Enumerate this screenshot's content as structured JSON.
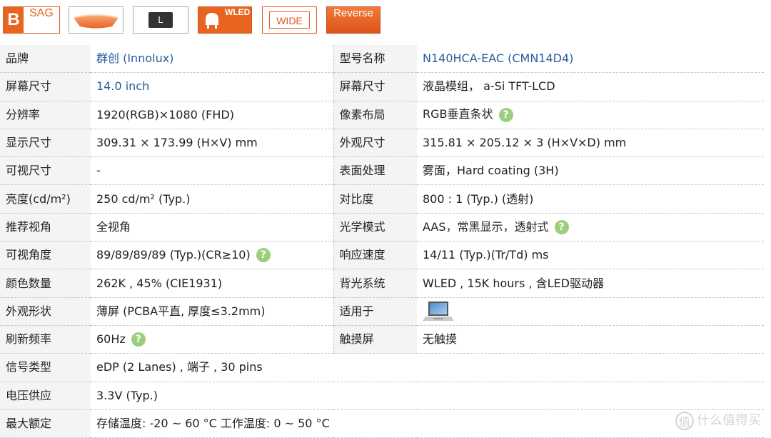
{
  "badges": {
    "sag": {
      "letter": "B",
      "text": "SAG",
      "icon": "sag-panel-icon"
    },
    "screen": {
      "icon": "panel-curve-icon"
    },
    "l": {
      "text": "L",
      "icon": "l-badge-icon"
    },
    "wled": {
      "text": "WLED",
      "icon": "wled-bulb-icon"
    },
    "wide": {
      "text": "WIDE",
      "icon": "wide-gamut-icon"
    },
    "reverse": {
      "text": "Reverse",
      "icon": "reverse-icon"
    }
  },
  "colors": {
    "accent": "#e8641f",
    "link": "#2a5d9c",
    "help": "#9ccf7c",
    "label_bg": "#f4f4f4"
  },
  "rows": [
    {
      "l1": "品牌",
      "v1": "群创 (Innolux)",
      "l2": "型号名称",
      "v2": "N140HCA-EAC (CMN14D4)"
    },
    {
      "l1": "屏幕尺寸",
      "v1": "14.0 inch",
      "l2": "屏幕尺寸",
      "v2": "液晶模组， a-Si TFT-LCD"
    },
    {
      "l1": "分辨率",
      "v1": "1920(RGB)×1080 (FHD)",
      "l2": "像素布局",
      "v2": "RGB垂直条状"
    },
    {
      "l1": "显示尺寸",
      "v1": "309.31 × 173.99 (H×V) mm",
      "l2": "外观尺寸",
      "v2": "315.81 × 205.12 × 3 (H×V×D) mm"
    },
    {
      "l1": "可视尺寸",
      "v1": "-",
      "l2": "表面处理",
      "v2": "雾面，Hard coating (3H)"
    },
    {
      "l1": "亮度(cd/m²)",
      "v1": "250 cd/m² (Typ.)",
      "l2": "对比度",
      "v2": "800 : 1 (Typ.) (透射)"
    },
    {
      "l1": "推荐视角",
      "v1": "全视角",
      "l2": "光学模式",
      "v2": "AAS，常黑显示，透射式"
    },
    {
      "l1": "可视角度",
      "v1": "89/89/89/89 (Typ.)(CR≥10)",
      "l2": "响应速度",
      "v2": "14/11 (Typ.)(Tr/Td) ms"
    },
    {
      "l1": "颜色数量",
      "v1": "262K , 45% (CIE1931)",
      "l2": "背光系统",
      "v2": "WLED , 15K hours , 含LED驱动器"
    },
    {
      "l1": "外观形状",
      "v1": "薄屏 (PCBA平直, 厚度≤3.2mm)",
      "l2": "适用于",
      "v2": ""
    },
    {
      "l1": "刷新频率",
      "v1": "60Hz",
      "l2": "触摸屏",
      "v2": "无触摸"
    },
    {
      "l1": "信号类型",
      "v1": "eDP (2 Lanes) , 端子 , 30 pins"
    },
    {
      "l1": "电压供应",
      "v1": "3.3V (Typ.)"
    },
    {
      "l1": "最大额定",
      "v1": "存储温度: -20 ~ 60 °C 工作温度: 0 ~ 50 °C"
    }
  ],
  "help_icon": {
    "glyph": "?",
    "icon": "help-icon"
  },
  "laptop_icon": "laptop-icon",
  "watermark": {
    "icon": "smzdm-logo-icon",
    "glyph": "值",
    "text": "什么值得买"
  }
}
